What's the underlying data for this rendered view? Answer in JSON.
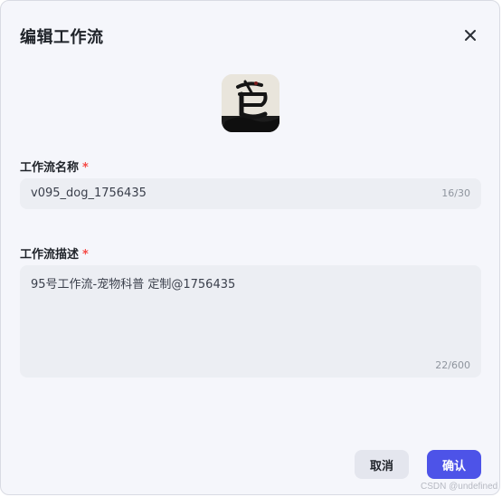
{
  "dialog": {
    "title": "编辑工作流",
    "close_icon": "close-icon"
  },
  "avatar": {
    "icon": "workflow-avatar-image"
  },
  "name_field": {
    "label": "工作流名称",
    "required_mark": "*",
    "value": "v095_dog_1756435",
    "counter": "16/30"
  },
  "desc_field": {
    "label": "工作流描述",
    "required_mark": "*",
    "value": "95号工作流-宠物科普 定制@1756435",
    "counter": "22/600"
  },
  "footer": {
    "cancel_label": "取消",
    "confirm_label": "确认"
  },
  "watermark": "CSDN @undefined",
  "colors": {
    "primary": "#4d53e8",
    "required": "#f54a45",
    "dialog_bg": "#f5f6fb",
    "input_bg": "#eceef3"
  }
}
